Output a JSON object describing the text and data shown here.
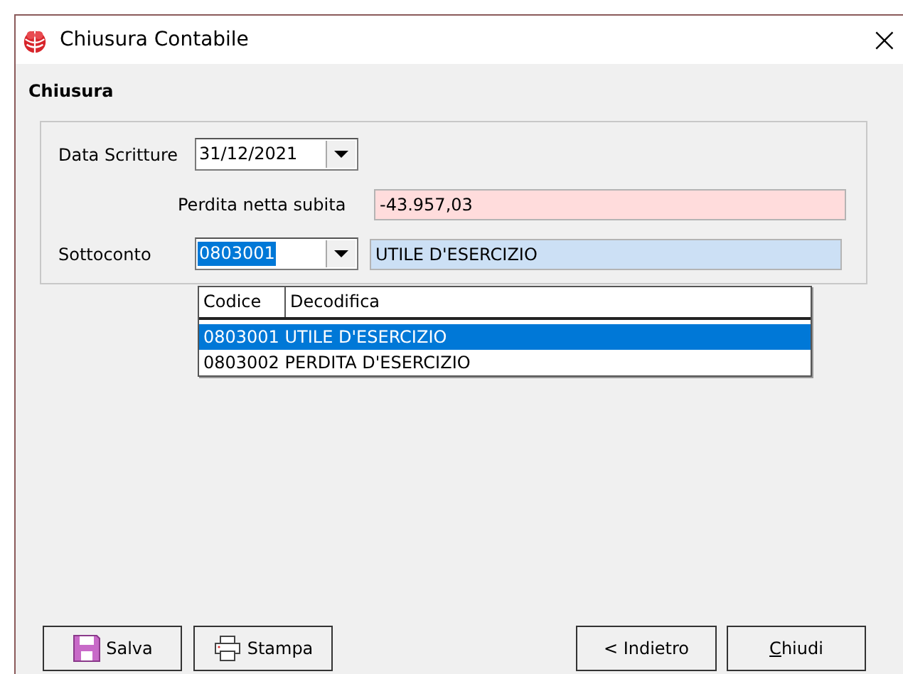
{
  "window": {
    "title": "Chiusura Contabile",
    "close": "×"
  },
  "section_title": "Chiusura",
  "fields": [
    {
      "kind": "date",
      "label": "Data Scritture",
      "value": "31/12/2021"
    },
    {
      "kind": "readonly",
      "label": "Perdita netta subita",
      "value": "-43.957,03",
      "color": "#ffdcdc"
    },
    {
      "kind": "lookup",
      "label": "Sottoconto",
      "value": "0803001",
      "text_selected": true,
      "description": "UTILE D'ESERCIZIO",
      "color": "#cce0f5"
    }
  ],
  "dropdown": {
    "columns": [
      "Codice",
      "Decodifica"
    ],
    "rows": [
      {
        "code": "0803001",
        "description": "UTILE D'ESERCIZIO",
        "selected": true
      },
      {
        "code": "0803002",
        "description": "PERDITA D'ESERCIZIO",
        "selected": false
      }
    ]
  },
  "buttons": [
    {
      "kind": "save",
      "label": "Salva"
    },
    {
      "kind": "print",
      "label": "Stampa"
    },
    {
      "kind": "back",
      "label": "< Indietro"
    },
    {
      "kind": "close",
      "label": "Chiudi",
      "mnemonic_first_letter": true
    }
  ]
}
